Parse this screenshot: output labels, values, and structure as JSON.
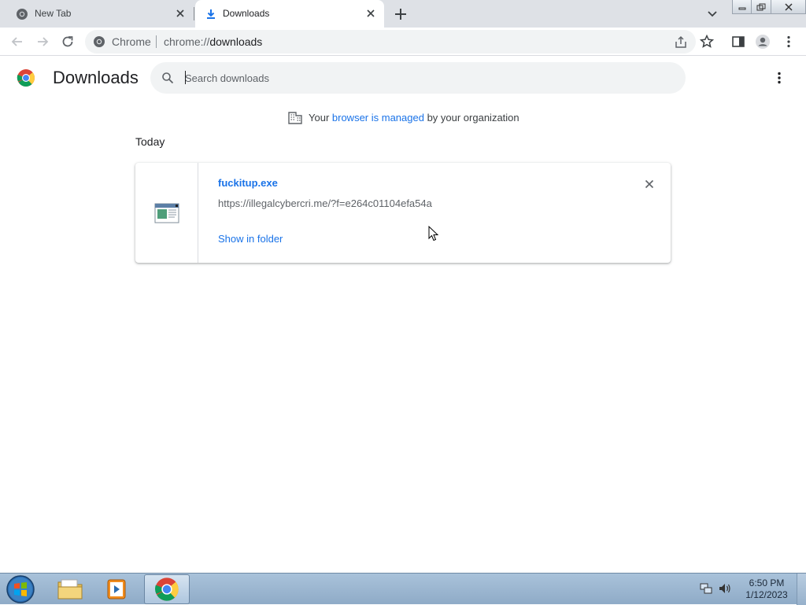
{
  "tabs": [
    {
      "label": "New Tab",
      "icon": "chrome-icon"
    },
    {
      "label": "Downloads",
      "icon": "download-icon"
    }
  ],
  "omnibox": {
    "site_label": "Chrome",
    "url_scheme": "chrome://",
    "url_path": "downloads"
  },
  "page": {
    "title": "Downloads"
  },
  "search": {
    "placeholder": "Search downloads",
    "value": ""
  },
  "managed_notice": {
    "prefix": "Your ",
    "link": "browser is managed",
    "suffix": " by your organization"
  },
  "date_heading": "Today",
  "downloads": [
    {
      "file_name": "fuckitup.exe",
      "url": "https://illegalcybercri.me/?f=e264c01104efa54a",
      "action": "Show in folder"
    }
  ],
  "taskbar": {
    "apps": [
      "windows-explorer",
      "media-player",
      "google-chrome"
    ],
    "time": "6:50 PM",
    "date": "1/12/2023"
  },
  "colors": {
    "link": "#1a73e8",
    "tabstrip": "#dee1e6",
    "taskbar": "#98b3ce"
  }
}
